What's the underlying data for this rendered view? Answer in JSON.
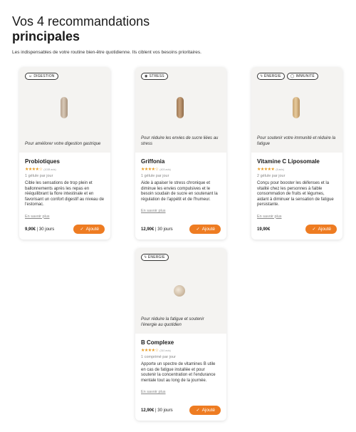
{
  "header": {
    "title_line1": "Vos 4 recommandations",
    "title_line2": "principales",
    "subtitle": "Les indispensables de votre routine bien-être quotidienne. Ils ciblent vos besoins prioritaires."
  },
  "colors": {
    "accent": "#ee7c22",
    "stars": "#e89b20",
    "card_top": "#f4f3f1"
  },
  "cards": [
    {
      "tags": [
        {
          "label": "DIGESTION",
          "icon": "digestion-icon"
        }
      ],
      "tagline": "Pour améliorer votre digestion gastrique",
      "name": "Probiotiques",
      "stars": "★★★★☆",
      "rating_count": "(1028 avis)",
      "dose": "1 gélule par jour",
      "description": "Cible les sensations de trop plein et ballonnements après les repas en rééquilibrant la flore intestinale et en favorisant un confort digestif au niveau de l'estomac.",
      "more": "En savoir plus",
      "price": "9,90€",
      "separator": " | ",
      "period": "30 jours",
      "button": "Ajouté"
    },
    {
      "tags": [
        {
          "label": "STRESS",
          "icon": "stress-icon"
        }
      ],
      "tagline": "Pour réduire les envies de sucre liées au stress",
      "name": "Griffonia",
      "stars": "★★★★☆",
      "rating_count": "(403 avis)",
      "dose": "1 gélule par jour",
      "description": "Aide à apaiser le stress chronique et diminue les envies compulsives et le besoin soudain de sucre en soutenant la régulation de l'appétit et de l'humeur.",
      "more": "En savoir plus",
      "price": "12,90€",
      "separator": " | ",
      "period": "30 jours",
      "button": "Ajouté"
    },
    {
      "tags": [
        {
          "label": "ÉNERGIE",
          "icon": "energy-icon"
        },
        {
          "label": "IMMUNITÉ",
          "icon": "immunity-icon"
        }
      ],
      "tagline": "Pour soutenir votre immunité et réduire la fatigue",
      "name": "Vitamine C Liposomale",
      "stars": "★★★★★",
      "rating_count": "(5 avis)",
      "dose": "2 gélule par jour",
      "description": "Conçu pour booster les défenses et la vitalité chez les personnes à faible consommation de fruits et légumes, aidant à diminuer la sensation de fatigue persistante.",
      "more": "En savoir plus",
      "price": "19,90€",
      "separator": "",
      "period": "",
      "button": "Ajouté"
    },
    {
      "tags": [
        {
          "label": "ÉNERGIE",
          "icon": "energy-icon"
        }
      ],
      "tagline": "Pour réduire la fatigue et soutenir l'énergie au quotidien",
      "name": "B Complexe",
      "stars": "★★★★☆",
      "rating_count": "(310 avis)",
      "dose": "1 comprimé par jour",
      "description": "Apporte un spectre de vitamines B utile en cas de fatigue installée et pour soutenir la concentration et l'endurance mentale tout au long de la journée.",
      "more": "En savoir plus",
      "price": "12,90€",
      "separator": " | ",
      "period": "30 jours",
      "button": "Ajouté"
    }
  ]
}
